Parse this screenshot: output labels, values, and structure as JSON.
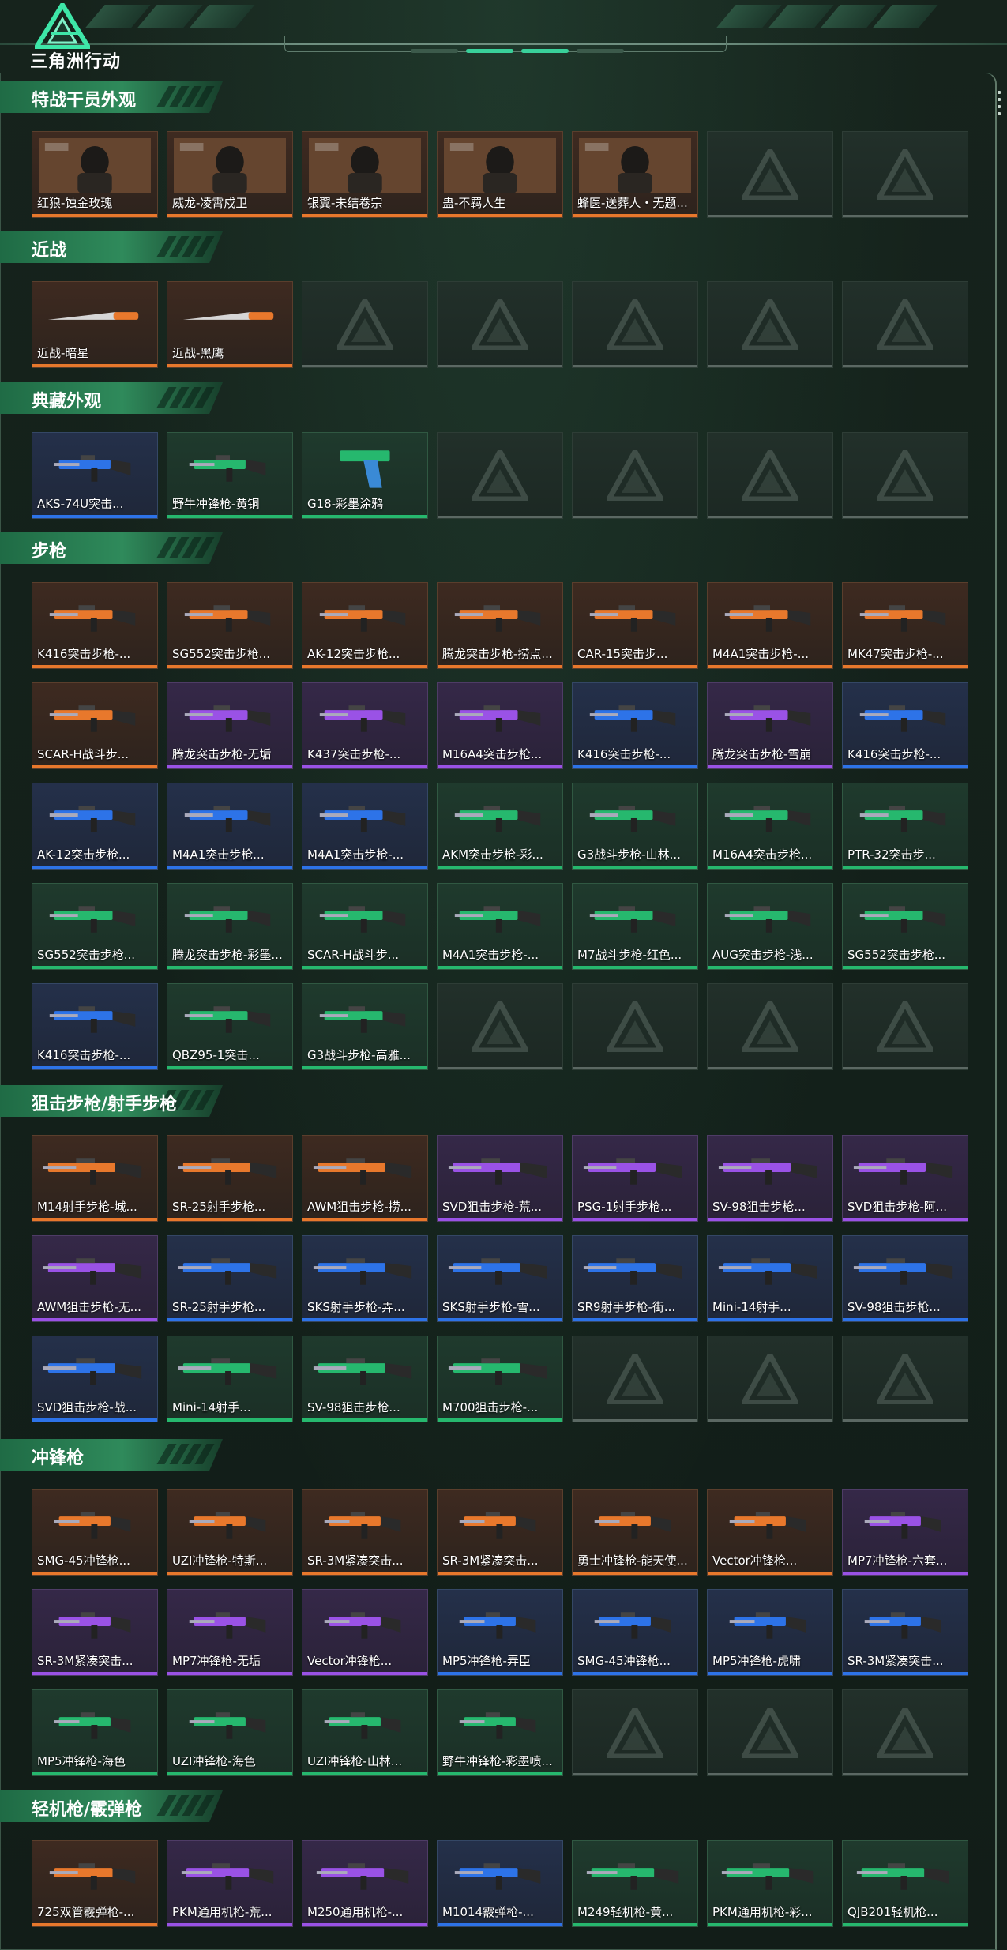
{
  "logo_text": "三角洲行动",
  "colors": {
    "orange": "#e8782c",
    "purple": "#9a52e6",
    "blue": "#2d73e8",
    "green": "#26b86e",
    "accent": "#39d09a"
  },
  "sections": [
    {
      "title": "特战干员外观",
      "items": [
        {
          "label": "红狼-蚀金玫瑰",
          "rarity": "orange",
          "kind": "photo"
        },
        {
          "label": "威龙-凌霄戍卫",
          "rarity": "orange",
          "kind": "photo"
        },
        {
          "label": "银翼-未结卷宗",
          "rarity": "orange",
          "kind": "photo"
        },
        {
          "label": "蛊-不羁人生",
          "rarity": "orange",
          "kind": "photo"
        },
        {
          "label": "蜂医-送葬人・无题...",
          "rarity": "orange",
          "kind": "photo"
        },
        {
          "label": "",
          "rarity": "empty"
        },
        {
          "label": "",
          "rarity": "empty"
        }
      ]
    },
    {
      "title": "近战",
      "items": [
        {
          "label": "近战-暗星",
          "rarity": "orange",
          "kind": "knife"
        },
        {
          "label": "近战-黑鹰",
          "rarity": "orange",
          "kind": "knife"
        },
        {
          "label": "",
          "rarity": "empty"
        },
        {
          "label": "",
          "rarity": "empty"
        },
        {
          "label": "",
          "rarity": "empty"
        },
        {
          "label": "",
          "rarity": "empty"
        },
        {
          "label": "",
          "rarity": "empty"
        }
      ]
    },
    {
      "title": "典藏外观",
      "items": [
        {
          "label": "AKS-74U突击...",
          "rarity": "blue",
          "kind": "smg"
        },
        {
          "label": "野牛冲锋枪-黄铜",
          "rarity": "green",
          "kind": "smg"
        },
        {
          "label": "G18-彩墨涂鸦",
          "rarity": "green",
          "kind": "pistol"
        },
        {
          "label": "",
          "rarity": "empty"
        },
        {
          "label": "",
          "rarity": "empty"
        },
        {
          "label": "",
          "rarity": "empty"
        },
        {
          "label": "",
          "rarity": "empty"
        }
      ]
    },
    {
      "title": "步枪",
      "items": [
        {
          "label": "K416突击步枪-...",
          "rarity": "orange",
          "kind": "rifle"
        },
        {
          "label": "SG552突击步枪...",
          "rarity": "orange",
          "kind": "rifle"
        },
        {
          "label": "AK-12突击步枪...",
          "rarity": "orange",
          "kind": "rifle"
        },
        {
          "label": "腾龙突击步枪-捞点...",
          "rarity": "orange",
          "kind": "rifle"
        },
        {
          "label": "CAR-15突击步...",
          "rarity": "orange",
          "kind": "rifle"
        },
        {
          "label": "M4A1突击步枪-...",
          "rarity": "orange",
          "kind": "rifle"
        },
        {
          "label": "MK47突击步枪-...",
          "rarity": "orange",
          "kind": "rifle"
        },
        {
          "label": "SCAR-H战斗步...",
          "rarity": "orange",
          "kind": "rifle"
        },
        {
          "label": "腾龙突击步枪-无垢",
          "rarity": "purple",
          "kind": "rifle"
        },
        {
          "label": "K437突击步枪-...",
          "rarity": "purple",
          "kind": "rifle"
        },
        {
          "label": "M16A4突击步枪...",
          "rarity": "purple",
          "kind": "rifle"
        },
        {
          "label": "K416突击步枪-...",
          "rarity": "blue",
          "kind": "rifle"
        },
        {
          "label": "腾龙突击步枪-雪崩",
          "rarity": "purple",
          "kind": "rifle"
        },
        {
          "label": "K416突击步枪-...",
          "rarity": "blue",
          "kind": "rifle"
        },
        {
          "label": "AK-12突击步枪...",
          "rarity": "blue",
          "kind": "rifle"
        },
        {
          "label": "M4A1突击步枪...",
          "rarity": "blue",
          "kind": "rifle"
        },
        {
          "label": "M4A1突击步枪-...",
          "rarity": "blue",
          "kind": "rifle"
        },
        {
          "label": "AKM突击步枪-彩...",
          "rarity": "green",
          "kind": "rifle"
        },
        {
          "label": "G3战斗步枪-山林...",
          "rarity": "green",
          "kind": "rifle"
        },
        {
          "label": "M16A4突击步枪...",
          "rarity": "green",
          "kind": "rifle"
        },
        {
          "label": "PTR-32突击步...",
          "rarity": "green",
          "kind": "rifle"
        },
        {
          "label": "SG552突击步枪...",
          "rarity": "green",
          "kind": "rifle"
        },
        {
          "label": "腾龙突击步枪-彩墨...",
          "rarity": "green",
          "kind": "rifle"
        },
        {
          "label": "SCAR-H战斗步...",
          "rarity": "green",
          "kind": "rifle"
        },
        {
          "label": "M4A1突击步枪-...",
          "rarity": "green",
          "kind": "rifle"
        },
        {
          "label": "M7战斗步枪-红色...",
          "rarity": "green",
          "kind": "rifle"
        },
        {
          "label": "AUG突击步枪-浅...",
          "rarity": "green",
          "kind": "rifle"
        },
        {
          "label": "SG552突击步枪...",
          "rarity": "green",
          "kind": "rifle"
        },
        {
          "label": "K416突击步枪-...",
          "rarity": "blue",
          "kind": "rifle"
        },
        {
          "label": "QBZ95-1突击...",
          "rarity": "green",
          "kind": "rifle"
        },
        {
          "label": "G3战斗步枪-高雅...",
          "rarity": "green",
          "kind": "rifle"
        },
        {
          "label": "",
          "rarity": "empty"
        },
        {
          "label": "",
          "rarity": "empty"
        },
        {
          "label": "",
          "rarity": "empty"
        },
        {
          "label": "",
          "rarity": "empty"
        }
      ]
    },
    {
      "title": "狙击步枪/射手步枪",
      "items": [
        {
          "label": "M14射手步枪-城...",
          "rarity": "orange",
          "kind": "sniper"
        },
        {
          "label": "SR-25射手步枪...",
          "rarity": "orange",
          "kind": "sniper"
        },
        {
          "label": "AWM狙击步枪-捞...",
          "rarity": "orange",
          "kind": "sniper"
        },
        {
          "label": "SVD狙击步枪-荒...",
          "rarity": "purple",
          "kind": "sniper"
        },
        {
          "label": "PSG-1射手步枪...",
          "rarity": "purple",
          "kind": "sniper"
        },
        {
          "label": "SV-98狙击步枪...",
          "rarity": "purple",
          "kind": "sniper"
        },
        {
          "label": "SVD狙击步枪-阿...",
          "rarity": "purple",
          "kind": "sniper"
        },
        {
          "label": "AWM狙击步枪-无...",
          "rarity": "purple",
          "kind": "sniper"
        },
        {
          "label": "SR-25射手步枪...",
          "rarity": "blue",
          "kind": "sniper"
        },
        {
          "label": "SKS射手步枪-弄...",
          "rarity": "blue",
          "kind": "sniper"
        },
        {
          "label": "SKS射手步枪-雪...",
          "rarity": "blue",
          "kind": "sniper"
        },
        {
          "label": "SR9射手步枪-街...",
          "rarity": "blue",
          "kind": "sniper"
        },
        {
          "label": "Mini-14射手...",
          "rarity": "blue",
          "kind": "sniper"
        },
        {
          "label": "SV-98狙击步枪...",
          "rarity": "blue",
          "kind": "sniper"
        },
        {
          "label": "SVD狙击步枪-战...",
          "rarity": "blue",
          "kind": "sniper"
        },
        {
          "label": "Mini-14射手...",
          "rarity": "green",
          "kind": "sniper"
        },
        {
          "label": "SV-98狙击步枪...",
          "rarity": "green",
          "kind": "sniper"
        },
        {
          "label": "M700狙击步枪-...",
          "rarity": "green",
          "kind": "sniper"
        },
        {
          "label": "",
          "rarity": "empty"
        },
        {
          "label": "",
          "rarity": "empty"
        },
        {
          "label": "",
          "rarity": "empty"
        }
      ]
    },
    {
      "title": "冲锋枪",
      "items": [
        {
          "label": "SMG-45冲锋枪...",
          "rarity": "orange",
          "kind": "smg"
        },
        {
          "label": "UZI冲锋枪-特斯...",
          "rarity": "orange",
          "kind": "smg"
        },
        {
          "label": "SR-3M紧凑突击...",
          "rarity": "orange",
          "kind": "smg"
        },
        {
          "label": "SR-3M紧凑突击...",
          "rarity": "orange",
          "kind": "smg"
        },
        {
          "label": "勇士冲锋枪-能天使...",
          "rarity": "orange",
          "kind": "smg"
        },
        {
          "label": "Vector冲锋枪...",
          "rarity": "orange",
          "kind": "smg"
        },
        {
          "label": "MP7冲锋枪-六套...",
          "rarity": "purple",
          "kind": "smg"
        },
        {
          "label": "SR-3M紧凑突击...",
          "rarity": "purple",
          "kind": "smg"
        },
        {
          "label": "MP7冲锋枪-无垢",
          "rarity": "purple",
          "kind": "smg"
        },
        {
          "label": "Vector冲锋枪...",
          "rarity": "purple",
          "kind": "smg"
        },
        {
          "label": "MP5冲锋枪-弄臣",
          "rarity": "blue",
          "kind": "smg"
        },
        {
          "label": "SMG-45冲锋枪...",
          "rarity": "blue",
          "kind": "smg"
        },
        {
          "label": "MP5冲锋枪-虎啸",
          "rarity": "blue",
          "kind": "smg"
        },
        {
          "label": "SR-3M紧凑突击...",
          "rarity": "blue",
          "kind": "smg"
        },
        {
          "label": "MP5冲锋枪-海色",
          "rarity": "green",
          "kind": "smg"
        },
        {
          "label": "UZI冲锋枪-海色",
          "rarity": "green",
          "kind": "smg"
        },
        {
          "label": "UZI冲锋枪-山林...",
          "rarity": "green",
          "kind": "smg"
        },
        {
          "label": "野牛冲锋枪-彩墨喷...",
          "rarity": "green",
          "kind": "smg"
        },
        {
          "label": "",
          "rarity": "empty"
        },
        {
          "label": "",
          "rarity": "empty"
        },
        {
          "label": "",
          "rarity": "empty"
        }
      ]
    },
    {
      "title": "轻机枪/霰弹枪",
      "items": [
        {
          "label": "725双管霰弹枪-...",
          "rarity": "orange",
          "kind": "shotgun"
        },
        {
          "label": "PKM通用机枪-荒...",
          "rarity": "purple",
          "kind": "lmg"
        },
        {
          "label": "M250通用机枪-...",
          "rarity": "purple",
          "kind": "lmg"
        },
        {
          "label": "M1014霰弹枪-...",
          "rarity": "blue",
          "kind": "shotgun"
        },
        {
          "label": "M249轻机枪-黄...",
          "rarity": "green",
          "kind": "lmg"
        },
        {
          "label": "PKM通用机枪-彩...",
          "rarity": "green",
          "kind": "lmg"
        },
        {
          "label": "QJB201轻机枪...",
          "rarity": "green",
          "kind": "lmg"
        }
      ]
    }
  ]
}
